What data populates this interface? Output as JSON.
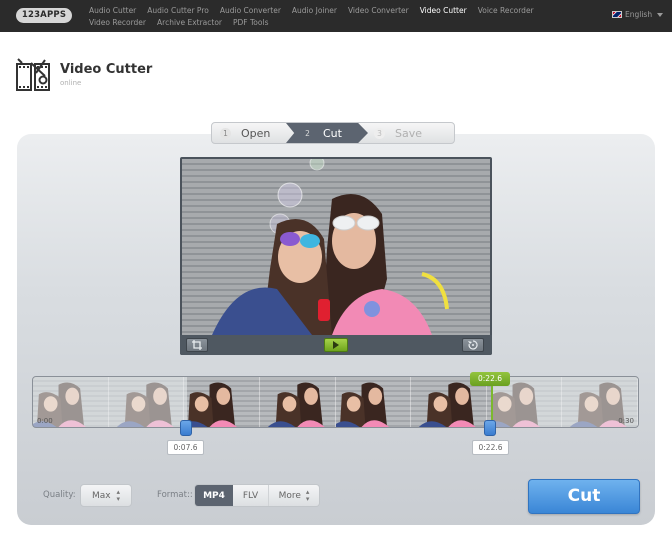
{
  "topbar": {
    "logo": "123APPS",
    "nav": [
      {
        "label": "Audio Cutter",
        "active": false
      },
      {
        "label": "Audio Cutter Pro",
        "active": false
      },
      {
        "label": "Audio Converter",
        "active": false
      },
      {
        "label": "Audio Joiner",
        "active": false
      },
      {
        "label": "Video Converter",
        "active": false
      },
      {
        "label": "Video Cutter",
        "active": true
      },
      {
        "label": "Voice Recorder",
        "active": false
      },
      {
        "label": "Video Recorder",
        "active": false
      },
      {
        "label": "Archive Extractor",
        "active": false
      },
      {
        "label": "PDF Tools",
        "active": false
      }
    ],
    "language": "English",
    "language_icon": "uk-flag-icon"
  },
  "header": {
    "title": "Video Cutter",
    "subtitle": "online",
    "icon": "film-scissors-icon"
  },
  "steps": [
    {
      "num": "1",
      "label": "Open",
      "state": "done"
    },
    {
      "num": "2",
      "label": "Cut",
      "state": "active"
    },
    {
      "num": "3",
      "label": "Save",
      "state": "pending"
    }
  ],
  "player": {
    "controls": {
      "crop_icon": "crop-icon",
      "play_icon": "play-icon",
      "rotate_icon": "rotate-icon"
    }
  },
  "timeline": {
    "start_label": "0:00",
    "end_label": "0:30",
    "selection_end_tag": "0:22.6",
    "handle_left_time": "0:07.6",
    "handle_right_time": "0:22.6",
    "frame_count": 8
  },
  "options": {
    "quality_label": "Quality:",
    "quality_value": "Max",
    "format_label": "Format::",
    "formats": [
      "MP4",
      "FLV",
      "More"
    ],
    "selected_format": "MP4"
  },
  "cut_button": "Cut",
  "colors": {
    "accent_blue": "#3a86d6",
    "accent_green": "#7cb82f",
    "step_active": "#5c6470",
    "topbar": "#2b2b2b"
  }
}
